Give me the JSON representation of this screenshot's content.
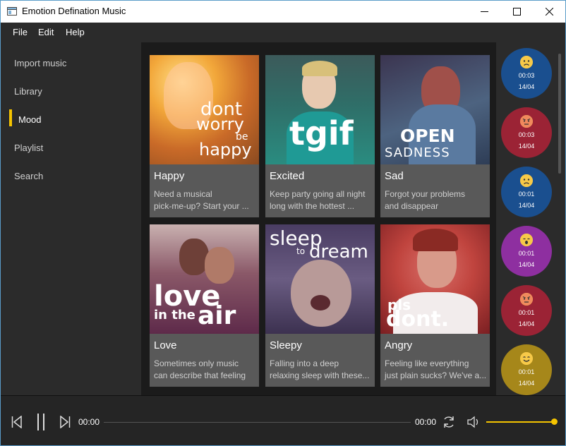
{
  "window": {
    "title": "Emotion Defination Music",
    "minimize": "minimize-icon",
    "maximize": "maximize-icon",
    "close": "close-icon"
  },
  "menu": [
    "File",
    "Edit",
    "Help"
  ],
  "sidebar": {
    "items": [
      {
        "label": "Import music"
      },
      {
        "label": "Library"
      },
      {
        "label": "Mood",
        "active": true
      },
      {
        "label": "Playlist"
      },
      {
        "label": "Search"
      }
    ]
  },
  "cards": [
    {
      "title": "Happy",
      "desc1": "Need a musical",
      "desc2": "pick-me-up? Start your ...",
      "art": [
        "dont",
        "worry",
        "be",
        "happy"
      ]
    },
    {
      "title": "Excited",
      "desc1": "Keep party going all night",
      "desc2": "long with the hottest ...",
      "art": [
        "tgif"
      ]
    },
    {
      "title": "Sad",
      "desc1": "Forgot your problems",
      "desc2": "and disappear",
      "art": [
        "OPEN",
        "SADNESS"
      ]
    },
    {
      "title": "Love",
      "desc1": "Sometimes only music",
      "desc2": "can describe that feeling",
      "art": [
        "love",
        "in the",
        "air"
      ]
    },
    {
      "title": "Sleepy",
      "desc1": "Falling into a deep",
      "desc2": "relaxing sleep with these...",
      "art": [
        "sleep",
        "to",
        "dream"
      ]
    },
    {
      "title": "Angry",
      "desc1": "Feeling like everything",
      "desc2": "just plain sucks? We've a...",
      "art": [
        "pls",
        "dont."
      ]
    }
  ],
  "history": [
    {
      "time": "00:03",
      "date": "14/04",
      "color": "#1a4f8f",
      "mood": "sad-face-icon"
    },
    {
      "time": "00:03",
      "date": "14/04",
      "color": "#9b2335",
      "mood": "angry-face-icon"
    },
    {
      "time": "00:01",
      "date": "14/04",
      "color": "#1a4f8f",
      "mood": "sad-face-icon"
    },
    {
      "time": "00:01",
      "date": "14/04",
      "color": "#8e2fa0",
      "mood": "sleepy-face-icon"
    },
    {
      "time": "00:01",
      "date": "14/04",
      "color": "#9b2335",
      "mood": "angry-face-icon"
    },
    {
      "time": "00:01",
      "date": "14/04",
      "color": "#a6871a",
      "mood": "happy-face-icon"
    }
  ],
  "player": {
    "current_time": "00:00",
    "total_time": "00:00",
    "progress": 0,
    "volume": 1.0,
    "accent": "#f5c400"
  }
}
